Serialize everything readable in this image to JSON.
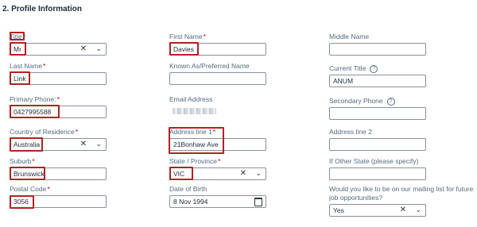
{
  "section": {
    "title": "2. Profile Information"
  },
  "col1": {
    "title": {
      "label": "Title",
      "value": "Mr"
    },
    "last_name": {
      "label": "Last Name",
      "value": "Link"
    },
    "primary_phone": {
      "label": "Primary Phone:",
      "value": "0427995588"
    },
    "country": {
      "label": "Country of Residence",
      "value": "Australia"
    },
    "suburb": {
      "label": "Suburb",
      "value": "Brunswick"
    },
    "postal_code": {
      "label": "Postal Code",
      "value": "3056"
    }
  },
  "col2": {
    "first_name": {
      "label": "First Name",
      "value": "Davies"
    },
    "known_as": {
      "label": "Known As/Preferred Name",
      "value": ""
    },
    "email": {
      "label": "Email Address"
    },
    "address1": {
      "label": "Address line 1",
      "value": "21Bonhaw Ave"
    },
    "state": {
      "label": "State / Province",
      "value": "VIC"
    },
    "dob": {
      "label": "Date of Birth",
      "value": "8 Nov 1994"
    }
  },
  "col3": {
    "middle_name": {
      "label": "Middle Name",
      "value": ""
    },
    "current_title": {
      "label": "Current Title",
      "value": "ANUM"
    },
    "secondary_phone": {
      "label": "Secondary Phone",
      "value": ""
    },
    "address2": {
      "label": "Address line 2",
      "value": ""
    },
    "other_state": {
      "label": "If Other State (please specify)",
      "value": ""
    },
    "mailing": {
      "label_1": "Would you like to be on our mailing list for future",
      "label_2": "job opportunities?",
      "value": "Yes"
    }
  },
  "glyphs": {
    "required": "*",
    "clear": "✕",
    "chevron": "⌄",
    "help": "?"
  },
  "colors": {
    "highlight": "#b22222",
    "required": "#bb0000",
    "border": "#89919a"
  },
  "icons": [
    "clear-icon",
    "chevron-down-icon",
    "help-icon",
    "calendar-icon"
  ]
}
